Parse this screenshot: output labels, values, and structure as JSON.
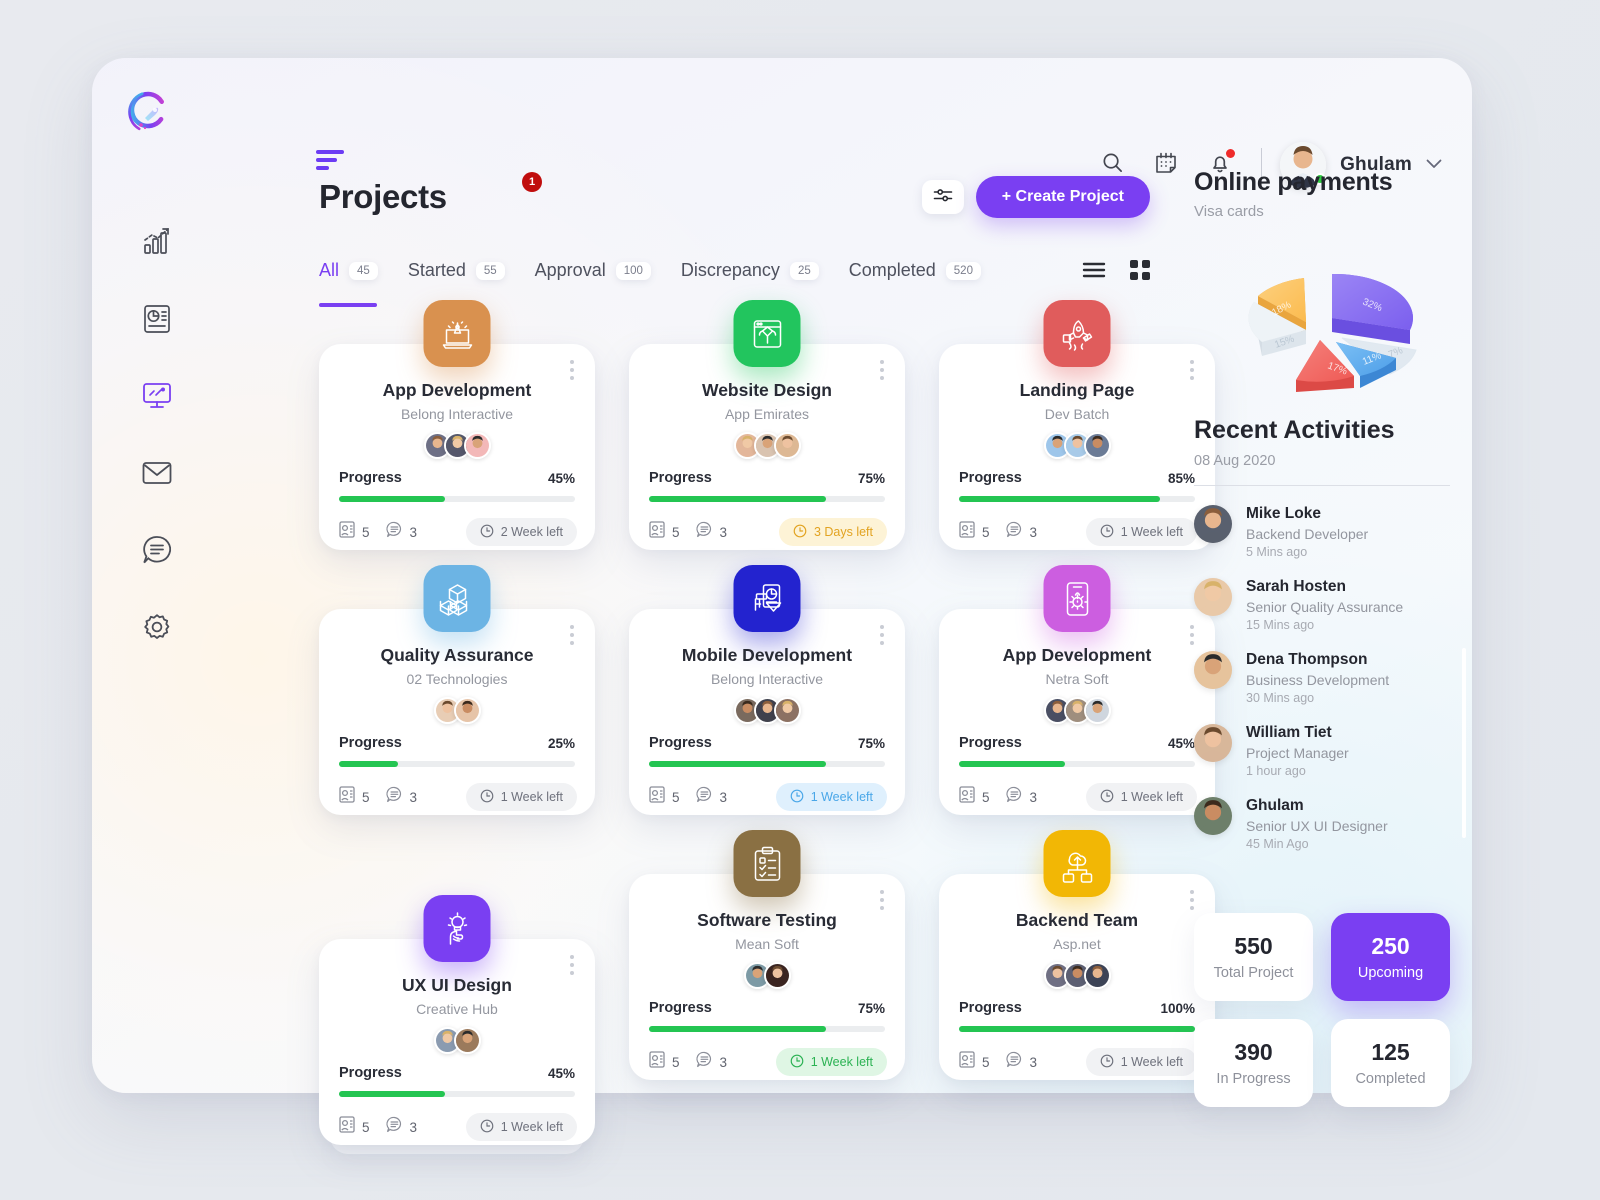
{
  "header": {
    "user_name": "Ghulam",
    "icons": [
      "search-icon",
      "calendar-icon",
      "bell-icon",
      "chevron-down-icon"
    ]
  },
  "sidebar": {
    "items": [
      {
        "name": "analytics",
        "icon": "bar-chart-growth-icon",
        "active": false
      },
      {
        "name": "reports",
        "icon": "report-document-icon",
        "active": false
      },
      {
        "name": "dashboard",
        "icon": "monitor-icon",
        "active": true
      },
      {
        "name": "mail",
        "icon": "envelope-icon",
        "active": false
      },
      {
        "name": "messages",
        "icon": "chat-bubble-icon",
        "active": false
      },
      {
        "name": "settings",
        "icon": "gear-icon",
        "active": false
      }
    ]
  },
  "main": {
    "page_title": "Projects",
    "title_badge": "1",
    "create_label": "+ Create Project",
    "tabs": [
      {
        "label": "All",
        "count": "45",
        "active": true
      },
      {
        "label": "Started",
        "count": "55",
        "active": false
      },
      {
        "label": "Approval",
        "count": "100",
        "active": false
      },
      {
        "label": "Discrepancy",
        "count": "25",
        "active": false
      },
      {
        "label": "Completed",
        "count": "520",
        "active": false
      }
    ],
    "cards": [
      {
        "name": "App Development",
        "company": "Belong Interactive",
        "progress": "45%",
        "progress_value": 45,
        "files": "5",
        "comments": "3",
        "due": "2 Week left",
        "due_style": "default",
        "icon": "rocket-laptop-icon",
        "icon_color": "#d9914f",
        "avatars": [
          "#6d6f85",
          "#55586b",
          "#f3b8b8"
        ]
      },
      {
        "name": "Website Design",
        "company": "App Emirates",
        "progress": "75%",
        "progress_value": 75,
        "files": "5",
        "comments": "3",
        "due": "3 Days left",
        "due_style": "warn",
        "icon": "pen-tool-browser-icon",
        "icon_color": "#22c55e",
        "avatars": [
          "#e3b79a",
          "#d9c3b0",
          "#ddb894"
        ]
      },
      {
        "name": "Landing Page",
        "company": "Dev Batch",
        "progress": "85%",
        "progress_value": 85,
        "files": "5",
        "comments": "3",
        "due": "1 Week left",
        "due_style": "default",
        "icon": "rocket-launch-icon",
        "icon_color": "#e05c5c",
        "avatars": [
          "#9ec6ea",
          "#a8cbe8",
          "#6b7b96"
        ]
      },
      {
        "name": "Quality Assurance",
        "company": "02 Technologies",
        "progress": "25%",
        "progress_value": 25,
        "files": "5",
        "comments": "3",
        "due": "1 Week left",
        "due_style": "default",
        "icon": "cubes-stack-icon",
        "icon_color": "#6cb4e4",
        "avatars": [
          "#e8cdb5",
          "#e6c4a8"
        ]
      },
      {
        "name": "Mobile Development",
        "company": "Belong Interactive",
        "progress": "75%",
        "progress_value": 75,
        "files": "5",
        "comments": "3",
        "due": "1 Week left",
        "due_style": "info",
        "icon": "mobile-chart-icon",
        "icon_color": "#2323cf",
        "avatars": [
          "#7a6a5e",
          "#40414d",
          "#8c7163"
        ]
      },
      {
        "name": "App Development",
        "company": "Netra Soft",
        "progress": "45%",
        "progress_value": 45,
        "files": "5",
        "comments": "3",
        "due": "1 Week left",
        "due_style": "default",
        "icon": "phone-gear-icon",
        "icon_color": "#cc5ee0",
        "avatars": [
          "#4a4f63",
          "#9f8e7e",
          "#cfd6de"
        ]
      },
      {
        "name": "UX UI Design",
        "company": "Creative Hub",
        "progress": "45%",
        "progress_value": 45,
        "files": "5",
        "comments": "3",
        "due": "1 Week left",
        "due_style": "default",
        "icon": "hand-bulb-icon",
        "icon_color": "#7a3ff2",
        "avatars": [
          "#8b9bb0",
          "#9b7a5c"
        ]
      },
      {
        "name": "Software Testing",
        "company": "Mean Soft",
        "progress": "75%",
        "progress_value": 75,
        "files": "5",
        "comments": "3",
        "due": "1 Week left",
        "due_style": "ok",
        "icon": "clipboard-checklist-icon",
        "icon_color": "#8a7043",
        "avatars": [
          "#7d9aa5",
          "#3a2420"
        ]
      },
      {
        "name": "Backend Team",
        "company": "Asp.net",
        "progress": "100%",
        "progress_value": 100,
        "files": "5",
        "comments": "3",
        "due": "1 Week left",
        "due_style": "default",
        "icon": "cloud-upload-devices-icon",
        "icon_color": "#f2b705",
        "avatars": [
          "#6f6f83",
          "#5c5f72",
          "#3d4356"
        ]
      }
    ]
  },
  "right": {
    "payments_title": "Online payments",
    "payments_sub": "Visa cards",
    "activities_title": "Recent Activities",
    "activities_date": "08 Aug 2020",
    "activities": [
      {
        "name": "Mike Loke",
        "role": "Backend Developer",
        "time": "5 Mins ago",
        "color": "#59606e"
      },
      {
        "name": "Sarah Hosten",
        "role": "Senior Quality Assurance",
        "time": "15 Mins ago",
        "color": "#e9c9a8"
      },
      {
        "name": "Dena Thompson",
        "role": "Business Development",
        "time": "30 Mins ago",
        "color": "#e6c39c"
      },
      {
        "name": "William Tiet",
        "role": "Project Manager",
        "time": "1 hour ago",
        "color": "#d8b79a"
      },
      {
        "name": "Ghulam",
        "role": "Senior UX UI Designer",
        "time": "45 Min Ago",
        "color": "#6d7f6a"
      }
    ],
    "stats": [
      {
        "value": "550",
        "label": "Total Project",
        "accent": false
      },
      {
        "value": "250",
        "label": "Upcoming",
        "accent": true
      },
      {
        "value": "390",
        "label": "In Progress",
        "accent": false
      },
      {
        "value": "125",
        "label": "Completed",
        "accent": false
      }
    ]
  },
  "chart_data": {
    "type": "pie",
    "title": "Online payments",
    "subtitle": "Visa cards",
    "labels": [
      "32%",
      "18%",
      "15%",
      "17%",
      "11%",
      "7%"
    ],
    "values": [
      32,
      18,
      15,
      17,
      11,
      7
    ],
    "colors": [
      "#8b6ff0",
      "#fbc562",
      "#e9eef3",
      "#f2635f",
      "#58aaf0",
      "#dbe5ee"
    ],
    "legend": "none",
    "style": "3d-exploded-donut"
  },
  "colors": {
    "accent": "#7a3ff2",
    "progress": "#24c552",
    "badge": "#c00d0d",
    "online": "#2ecc40"
  }
}
